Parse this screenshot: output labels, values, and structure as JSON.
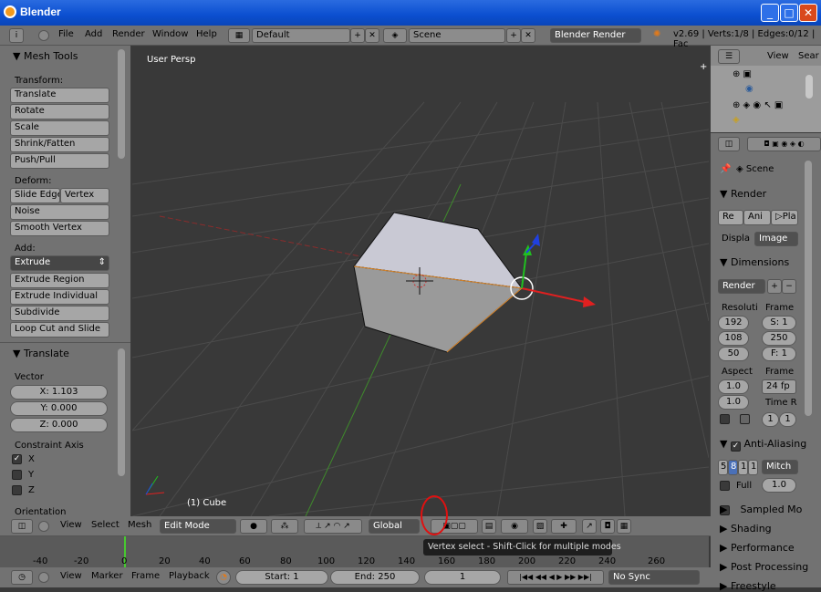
{
  "window": {
    "title": "Blender"
  },
  "info_header": {
    "menu": [
      "File",
      "Add",
      "Render",
      "Window",
      "Help"
    ],
    "layout": "Default",
    "scene": "Scene",
    "engine": "Blender Render",
    "stats": "v2.69 | Verts:1/8 | Edges:0/12 | Fac"
  },
  "toolshelf": {
    "header": "Mesh Tools",
    "transform_label": "Transform:",
    "transform": [
      "Translate",
      "Rotate",
      "Scale",
      "Shrink/Fatten",
      "Push/Pull"
    ],
    "deform_label": "Deform:",
    "deform_row": [
      "Slide Edge",
      "Vertex"
    ],
    "deform": [
      "Noise",
      "Smooth Vertex"
    ],
    "add_label": "Add:",
    "add_dropdown": "Extrude",
    "add": [
      "Extrude Region",
      "Extrude Individual",
      "Subdivide",
      "Loop Cut and Slide"
    ]
  },
  "operator": {
    "header": "Translate",
    "vector_label": "Vector",
    "x": "X: 1.103",
    "y": "Y: 0.000",
    "z": "Z: 0.000",
    "constraint_label": "Constraint Axis",
    "axes": [
      "X",
      "Y",
      "Z"
    ],
    "orientation_label": "Orientation"
  },
  "viewport": {
    "label": "User Persp",
    "object": "(1) Cube"
  },
  "view3d_header": {
    "menu": [
      "View",
      "Select",
      "Mesh"
    ],
    "mode": "Edit Mode",
    "orientation": "Global"
  },
  "tooltip": "Vertex select - Shift-Click for multiple modes",
  "timeline": {
    "ticks": [
      "-40",
      "-20",
      "0",
      "20",
      "40",
      "60",
      "80",
      "100",
      "120",
      "140",
      "160",
      "180",
      "200",
      "220",
      "240",
      "260"
    ],
    "menu": [
      "View",
      "Marker",
      "Frame",
      "Playback"
    ],
    "start": "Start: 1",
    "end": "End: 250",
    "current": "1",
    "sync": "No Sync"
  },
  "outliner": {
    "menu": [
      "View",
      "Sear"
    ]
  },
  "properties": {
    "scene": "Scene",
    "render_header": "Render",
    "render_buttons": [
      "Re",
      "Ani",
      "Pla"
    ],
    "display_label": "Displa",
    "display_value": "Image",
    "dimensions_header": "Dimensions",
    "preset": "Render",
    "resolution_label": "Resoluti",
    "frame_label": "Frame",
    "res": [
      "192",
      "108",
      "50"
    ],
    "frames": [
      "S: 1",
      "250",
      "F: 1"
    ],
    "aspect_label": "Aspect",
    "frame_rate_label": "Frame",
    "aspect": [
      "1.0",
      "1.0"
    ],
    "fps": "24 fp",
    "time_label": "Time R",
    "time": [
      "1",
      "1"
    ],
    "aa_header": "Anti-Aliasing",
    "aa_samples": [
      "5",
      "8",
      "1",
      "1"
    ],
    "filter": "Mitch",
    "full_label": "Full",
    "filter_size": "1.0",
    "collapsed": [
      "Sampled Mo",
      "Shading",
      "Performance",
      "Post Processing",
      "Freestyle"
    ]
  }
}
